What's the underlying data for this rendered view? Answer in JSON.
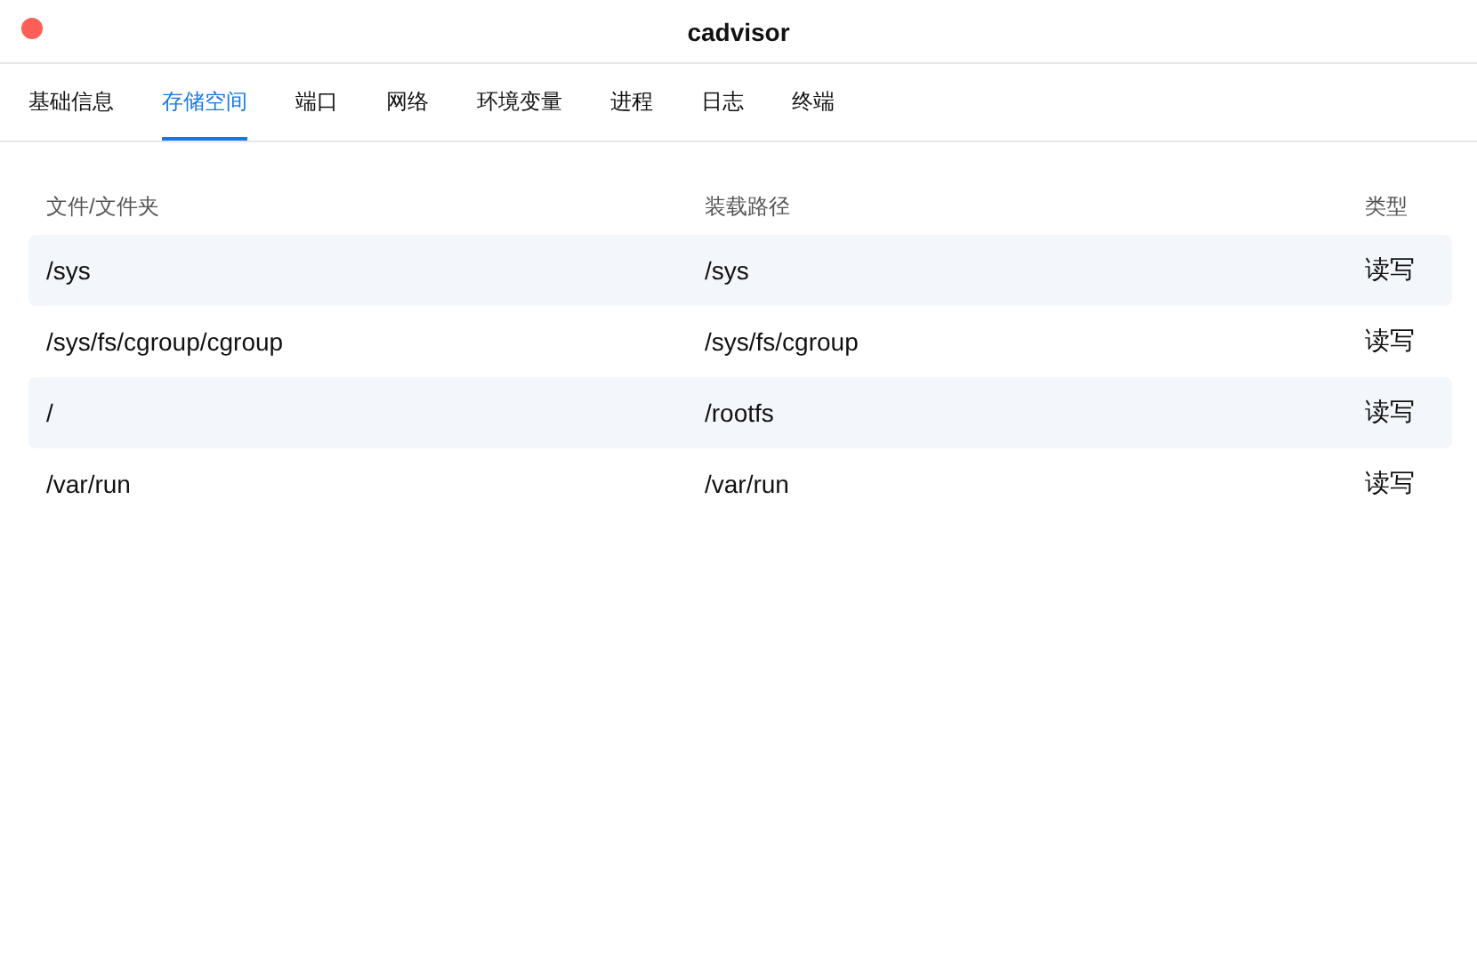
{
  "window": {
    "title": "cadvisor"
  },
  "tabs": [
    {
      "label": "基础信息",
      "selected": false
    },
    {
      "label": "存储空间",
      "selected": true
    },
    {
      "label": "端口",
      "selected": false
    },
    {
      "label": "网络",
      "selected": false
    },
    {
      "label": "环境变量",
      "selected": false
    },
    {
      "label": "进程",
      "selected": false
    },
    {
      "label": "日志",
      "selected": false
    },
    {
      "label": "终端",
      "selected": false
    }
  ],
  "table": {
    "columns": [
      "文件/文件夹",
      "装载路径",
      "类型"
    ],
    "rows": [
      [
        "/sys",
        "/sys",
        "读写"
      ],
      [
        "/sys/fs/cgroup/cgroup",
        "/sys/fs/cgroup",
        "读写"
      ],
      [
        "/",
        "/rootfs",
        "读写"
      ],
      [
        "/var/run",
        "/var/run",
        "读写"
      ]
    ]
  }
}
